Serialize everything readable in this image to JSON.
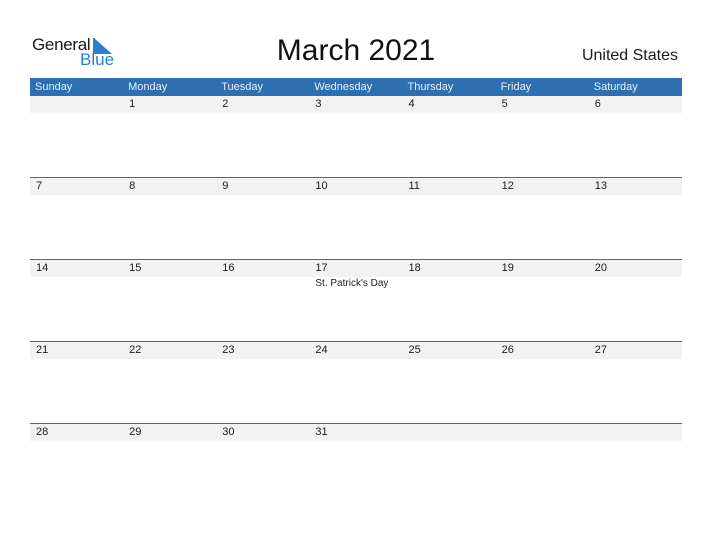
{
  "logo": {
    "word1": "General",
    "word2": "Blue"
  },
  "title": "March 2021",
  "country": "United States",
  "weekdays": [
    "Sunday",
    "Monday",
    "Tuesday",
    "Wednesday",
    "Thursday",
    "Friday",
    "Saturday"
  ],
  "weeks": [
    [
      {
        "d": ""
      },
      {
        "d": "1"
      },
      {
        "d": "2"
      },
      {
        "d": "3"
      },
      {
        "d": "4"
      },
      {
        "d": "5"
      },
      {
        "d": "6"
      }
    ],
    [
      {
        "d": "7"
      },
      {
        "d": "8"
      },
      {
        "d": "9"
      },
      {
        "d": "10"
      },
      {
        "d": "11"
      },
      {
        "d": "12"
      },
      {
        "d": "13"
      }
    ],
    [
      {
        "d": "14"
      },
      {
        "d": "15"
      },
      {
        "d": "16"
      },
      {
        "d": "17",
        "event": "St. Patrick's Day"
      },
      {
        "d": "18"
      },
      {
        "d": "19"
      },
      {
        "d": "20"
      }
    ],
    [
      {
        "d": "21"
      },
      {
        "d": "22"
      },
      {
        "d": "23"
      },
      {
        "d": "24"
      },
      {
        "d": "25"
      },
      {
        "d": "26"
      },
      {
        "d": "27"
      }
    ],
    [
      {
        "d": "28"
      },
      {
        "d": "29"
      },
      {
        "d": "30"
      },
      {
        "d": "31"
      },
      {
        "d": ""
      },
      {
        "d": ""
      },
      {
        "d": ""
      }
    ]
  ],
  "colors": {
    "accent": "#2e6fb1",
    "logo_blue": "#2a7fd4",
    "band": "#f2f2f2"
  }
}
